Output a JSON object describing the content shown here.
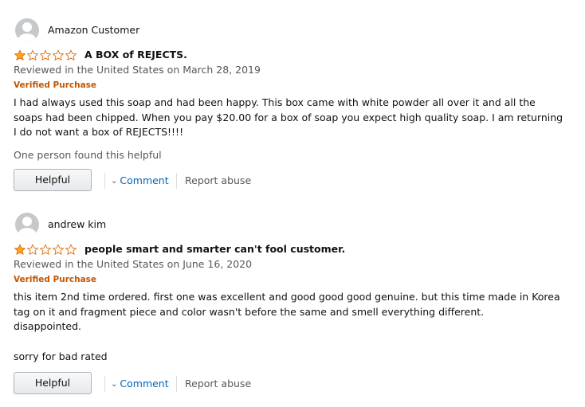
{
  "reviews": [
    {
      "author": "Amazon Customer",
      "rating": 1,
      "max_rating": 5,
      "title": "A BOX of REJECTS.",
      "reviewed_line": "Reviewed in the United States on March 28, 2019",
      "verified": "Verified Purchase",
      "body": [
        "I had always used this soap and had been happy. This box came with white powder all over it and all the soaps had been chipped. When you pay $20.00 for a box of soap you expect high quality soap. I am returning I do not want a box of REJECTS!!!!"
      ],
      "helpful_count": "One person found this helpful",
      "helpful_button": "Helpful",
      "comment_label": "Comment",
      "report_label": "Report abuse"
    },
    {
      "author": "andrew kim",
      "rating": 1,
      "max_rating": 5,
      "title": "people smart and smarter can't fool customer.",
      "reviewed_line": "Reviewed in the United States on June 16, 2020",
      "verified": "Verified Purchase",
      "body": [
        "this item 2nd time ordered. first one was excellent and good good good genuine. but this time made in Korea tag on it and fragment piece and color wasn't before the same and smell everything different.",
        "disappointed.",
        "",
        "sorry for bad rated"
      ],
      "helpful_button": "Helpful",
      "comment_label": "Comment",
      "report_label": "Report abuse"
    }
  ],
  "colors": {
    "star_filled": "#ffa41c",
    "star_outline": "#de7921",
    "verified": "#c45500",
    "link": "#0066c0",
    "muted": "#565959"
  },
  "icons": {
    "avatar": "default-user-avatar-icon",
    "star": "star-icon",
    "chevron": "chevron-down-icon"
  }
}
